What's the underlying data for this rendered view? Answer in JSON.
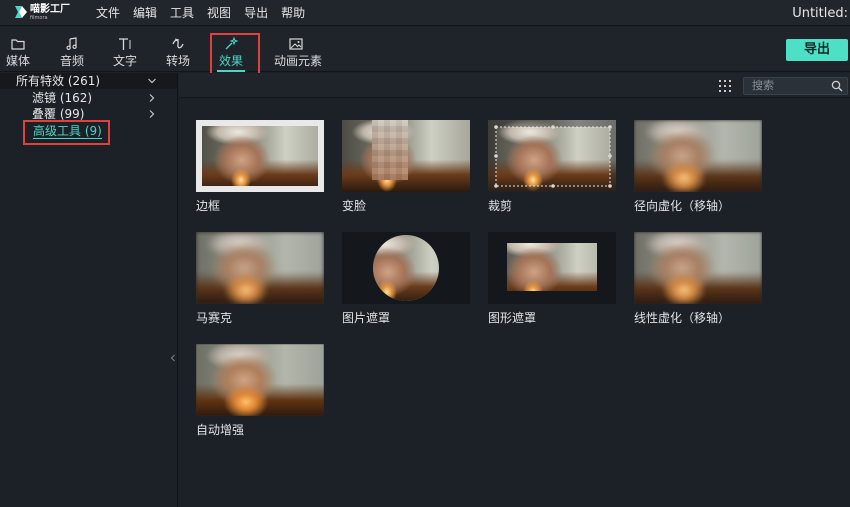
{
  "app": {
    "logo_name": "喵影工厂",
    "logo_sub": "filmora",
    "window_title": "Untitled:"
  },
  "menu": [
    "文件",
    "编辑",
    "工具",
    "视图",
    "导出",
    "帮助"
  ],
  "toolbar": {
    "tools": [
      {
        "label": "媒体",
        "icon": "folder-icon"
      },
      {
        "label": "音频",
        "icon": "music-note-icon"
      },
      {
        "label": "文字",
        "icon": "text-icon"
      },
      {
        "label": "转场",
        "icon": "transition-icon"
      },
      {
        "label": "效果",
        "icon": "magic-wand-icon",
        "active": true
      },
      {
        "label": "动画元素",
        "icon": "image-icon"
      }
    ],
    "export_label": "导出"
  },
  "sidebar": {
    "items": [
      {
        "label": "所有特效 (261)",
        "chevron": "down"
      },
      {
        "label": "滤镜 (162)",
        "chevron": "right"
      },
      {
        "label": "叠覆 (99)",
        "chevron": "right"
      },
      {
        "label": "高级工具 (9)",
        "selected": true
      }
    ]
  },
  "search": {
    "placeholder": "搜索"
  },
  "effects": [
    {
      "name": "边框"
    },
    {
      "name": "变脸"
    },
    {
      "name": "裁剪"
    },
    {
      "name": "径向虚化（移轴）"
    },
    {
      "name": "马赛克"
    },
    {
      "name": "图片遮罩"
    },
    {
      "name": "图形遮罩"
    },
    {
      "name": "线性虚化（移轴）"
    },
    {
      "name": "自动增强"
    }
  ],
  "colors": {
    "accent": "#4ed5c7",
    "export_button": "#4ee0c6",
    "highlight_box": "#e0413c",
    "background": "#1c2128"
  }
}
